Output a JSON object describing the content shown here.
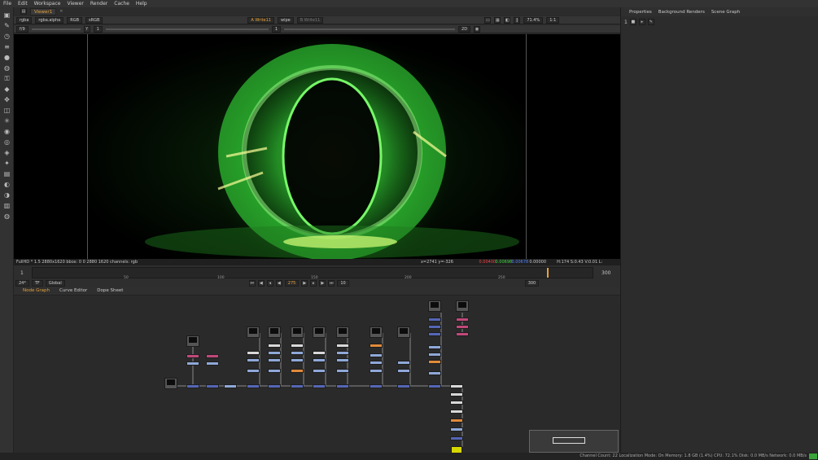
{
  "menubar": {
    "items": [
      "File",
      "Edit",
      "Workspace",
      "Viewer",
      "Render",
      "Cache",
      "Help"
    ]
  },
  "viewer": {
    "tab_label": "Viewer1",
    "channels": "rgba",
    "alpha": "rgba.alpha",
    "colorspace": "RGB",
    "lut": "sRGB",
    "input_a": "A  Write11",
    "operation": "wipe",
    "input_b": "B  Write11",
    "zoom": "71.4%",
    "ratio": "1:1",
    "mode": "2D",
    "frame_f": "f/9",
    "gain_val": "1",
    "gamma_val": "1",
    "info_left": "FullHD * 1.5 2880x1620  bbox: 0 0 2880 1620 channels: rgb",
    "info_coords": "x=2741 y=-326",
    "info_r": "0.00400",
    "info_g": "0.00698",
    "info_b": "0.00678",
    "info_a": "0.00000",
    "info_hsv": "H:174 S:0.43 V:0.01  L: 0.00633"
  },
  "timeline": {
    "start": "1",
    "end": "300",
    "end2": "300",
    "ticks": [
      "50",
      "100",
      "150",
      "200",
      "250"
    ],
    "current_frame": "275",
    "fps": "24*",
    "tf": "TF",
    "range_mode": "Global",
    "step": "10"
  },
  "nodegraph": {
    "tabs": [
      "Node Graph",
      "Curve Editor",
      "Dope Sheet"
    ]
  },
  "properties": {
    "tabs": [
      "Properties",
      "Background Renders",
      "Scene Graph"
    ],
    "count": "1"
  },
  "status": {
    "text": "Channel Count: 22  Localization Mode: On  Memory: 1.8 GB (1.4%)  CPU: 72.1%  Disk: 0.0 MB/s  Network: 0.0 MB/s"
  },
  "colors": {
    "accent": "#e6a23c",
    "green_glow": "#39ff3a",
    "node_blue": "#8fa8d8",
    "node_pink": "#c0487a"
  }
}
